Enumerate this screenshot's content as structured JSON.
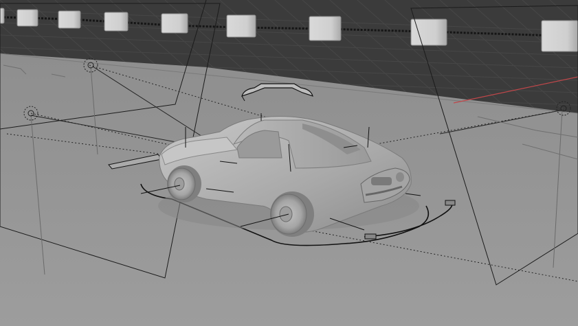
{
  "viewport": {
    "type": "3d-viewport",
    "shading": "solid",
    "scene": "car-rig-scene"
  },
  "colors": {
    "background": "#3a3a3a",
    "grid_dark": "#444444",
    "ground": "#9a9a9a",
    "car_body": "#b4b4b4",
    "car_shadow": "#8a8a8a",
    "wire": "#111111",
    "x_axis": "#c0474a"
  },
  "objects": {
    "car": {
      "name": "car-body"
    },
    "wheels": [
      "front-left-wheel",
      "rear-left-wheel"
    ],
    "cubes_count": 9,
    "lights": [
      "lamp-left",
      "lamp-mid",
      "lamp-right"
    ],
    "camera_frames": [
      "camera-frame-left",
      "camera-frame-right"
    ]
  }
}
